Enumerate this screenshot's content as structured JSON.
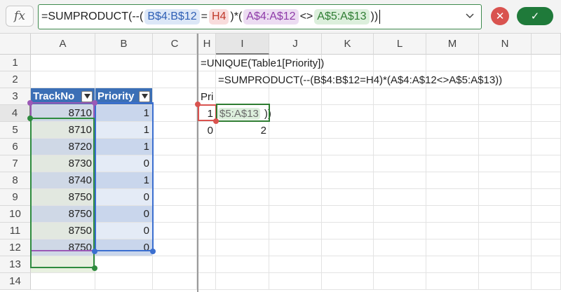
{
  "formula_bar": {
    "fx_label": "fx",
    "tokens": [
      {
        "text": "=SUMPRODUCT(--(",
        "kind": "plain"
      },
      {
        "text": "B$4:B$12",
        "kind": "blue"
      },
      {
        "text": "=",
        "kind": "plain"
      },
      {
        "text": "H4",
        "kind": "red"
      },
      {
        "text": ")*(",
        "kind": "plain"
      },
      {
        "text": "A$4:A$12",
        "kind": "purple"
      },
      {
        "text": "<>",
        "kind": "plain"
      },
      {
        "text": "A$5:A$13",
        "kind": "green"
      },
      {
        "text": "))",
        "kind": "plain"
      }
    ],
    "cancel_icon": "✕",
    "confirm_icon": "✓"
  },
  "columns": [
    "A",
    "B",
    "C",
    "H",
    "I",
    "J",
    "K",
    "L",
    "M",
    "N"
  ],
  "rows": [
    "1",
    "2",
    "3",
    "4",
    "5",
    "6",
    "7",
    "8",
    "9",
    "10",
    "11",
    "12",
    "13",
    "14"
  ],
  "table": {
    "headers": [
      "TrackNo",
      "Priority"
    ],
    "rows": [
      [
        "8710",
        "1"
      ],
      [
        "8710",
        "1"
      ],
      [
        "8720",
        "1"
      ],
      [
        "8730",
        "0"
      ],
      [
        "8740",
        "1"
      ],
      [
        "8750",
        "0"
      ],
      [
        "8750",
        "0"
      ],
      [
        "8750",
        "0"
      ],
      [
        "8750",
        "0"
      ]
    ]
  },
  "cells": {
    "H1": "=UNIQUE(Table1[Priority])",
    "H2_indent": "=SUMPRODUCT(--(B$4:B$12=H4)*(A$4:A$12<>A$5:A$13))",
    "H3": "Pri",
    "H4": "1",
    "I4_edit": "$5:A$13",
    "I4_tail": "))",
    "H5": "0",
    "I5": "2"
  },
  "colors": {
    "table_header": "#3b6fb6",
    "ref_blue": "#2e5fb5",
    "ref_red": "#c0392b",
    "ref_purple": "#8e3aa8",
    "ref_green": "#2e7d32"
  }
}
